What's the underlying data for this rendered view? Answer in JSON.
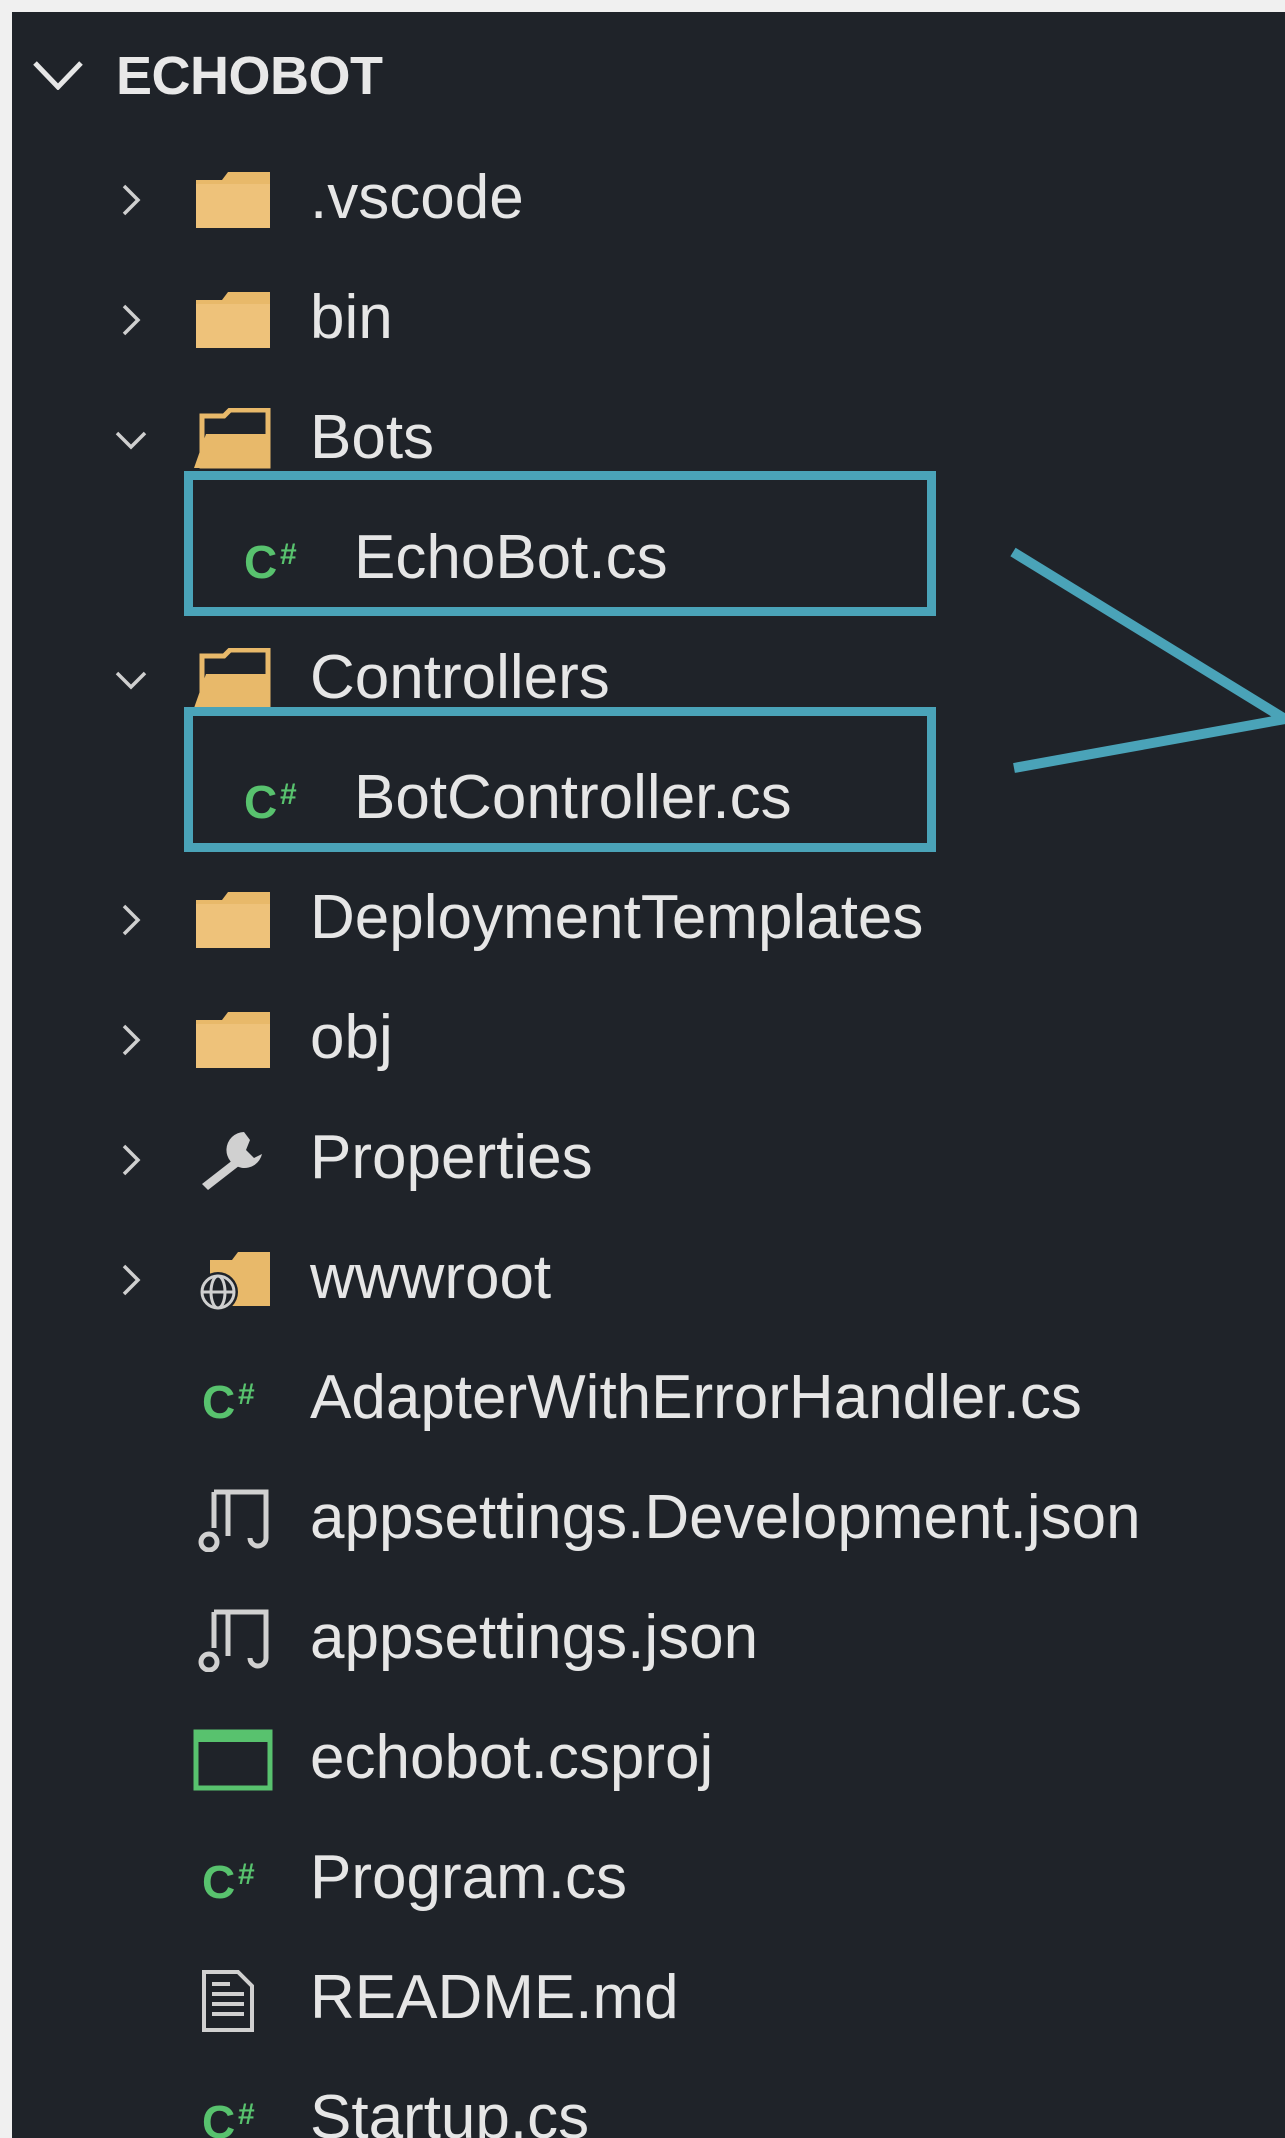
{
  "explorer": {
    "title": "ECHOBOT",
    "items": [
      {
        "label": ".vscode",
        "icon": "folder-icon",
        "arrow": "chevron-right-icon"
      },
      {
        "label": "bin",
        "icon": "folder-icon",
        "arrow": "chevron-right-icon"
      },
      {
        "label": "Bots",
        "icon": "folder-open-icon",
        "arrow": "chevron-down-icon"
      },
      {
        "label": "EchoBot.cs",
        "icon": "csharp-file-icon",
        "highlighted": true
      },
      {
        "label": "Controllers",
        "icon": "folder-open-icon",
        "arrow": "chevron-down-icon"
      },
      {
        "label": "BotController.cs",
        "icon": "csharp-file-icon",
        "highlighted": true
      },
      {
        "label": "DeploymentTemplates",
        "icon": "folder-icon",
        "arrow": "chevron-right-icon"
      },
      {
        "label": "obj",
        "icon": "folder-icon",
        "arrow": "chevron-right-icon"
      },
      {
        "label": "Properties",
        "icon": "wrench-icon",
        "arrow": "chevron-right-icon"
      },
      {
        "label": "wwwroot",
        "icon": "globe-folder-icon",
        "arrow": "chevron-right-icon"
      },
      {
        "label": "AdapterWithErrorHandler.cs",
        "icon": "csharp-file-icon"
      },
      {
        "label": "appsettings.Development.json",
        "icon": "settings-json-icon"
      },
      {
        "label": "appsettings.json",
        "icon": "settings-json-icon"
      },
      {
        "label": "echobot.csproj",
        "icon": "project-file-icon"
      },
      {
        "label": "Program.cs",
        "icon": "csharp-file-icon"
      },
      {
        "label": "README.md",
        "icon": "document-icon"
      },
      {
        "label": "Startup.cs",
        "icon": "csharp-file-icon"
      }
    ],
    "csharp_glyph": "C#"
  },
  "colors": {
    "background": "#1f2329",
    "text": "#e6e6e6",
    "folder": "#e8b96a",
    "csharp": "#58c26e",
    "highlight": "#4aa3b8"
  }
}
